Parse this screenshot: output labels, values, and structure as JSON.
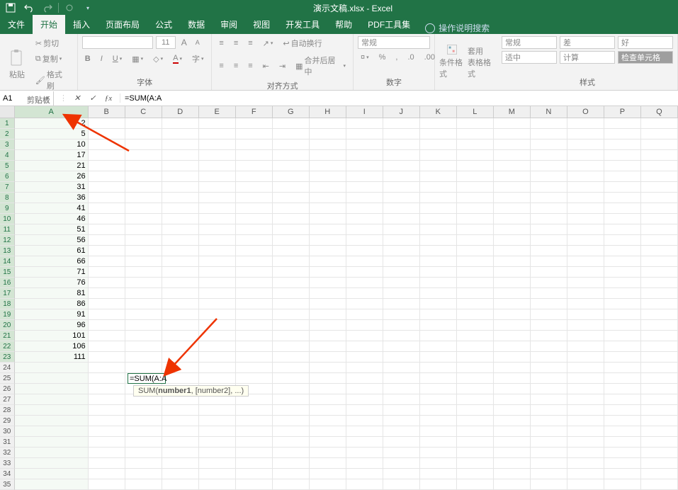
{
  "app": {
    "title": "演示文稿.xlsx - Excel"
  },
  "tabs": {
    "file": "文件",
    "home": "开始",
    "insert": "插入",
    "pagelayout": "页面布局",
    "formulas": "公式",
    "data": "数据",
    "review": "审阅",
    "view": "视图",
    "developer": "开发工具",
    "help": "帮助",
    "pdf": "PDF工具集",
    "tellme": "操作说明搜索"
  },
  "ribbon": {
    "clipboard": {
      "paste": "粘贴",
      "cut": "剪切",
      "copy": "复制",
      "formatpainter": "格式刷",
      "label": "剪贴板"
    },
    "font": {
      "size": "11",
      "label": "字体"
    },
    "align": {
      "wrap": "自动换行",
      "merge": "合并后居中",
      "label": "对齐方式"
    },
    "number": {
      "format": "常规",
      "label": "数字"
    },
    "styles": {
      "condfmt": "条件格式",
      "tablefmt": "套用\n表格格式",
      "normal": "常规",
      "bad": "差",
      "good": "好",
      "neutral": "适中",
      "calculation": "计算",
      "checkcell": "检查单元格",
      "label": "样式"
    }
  },
  "formulabar": {
    "name": "A1",
    "formula": "=SUM(A:A"
  },
  "columns": [
    "A",
    "B",
    "C",
    "D",
    "E",
    "F",
    "G",
    "H",
    "I",
    "J",
    "K",
    "L",
    "M",
    "N",
    "O",
    "P",
    "Q"
  ],
  "rowdata": [
    "2",
    "5",
    "10",
    "17",
    "21",
    "26",
    "31",
    "36",
    "41",
    "46",
    "51",
    "56",
    "61",
    "66",
    "71",
    "76",
    "81",
    "86",
    "91",
    "96",
    "101",
    "106",
    "111"
  ],
  "editing": {
    "celltext": "=SUM(A:A",
    "hint_fn": "SUM(",
    "hint_bold": "number1",
    "hint_rest": ", [number2], ...)"
  }
}
